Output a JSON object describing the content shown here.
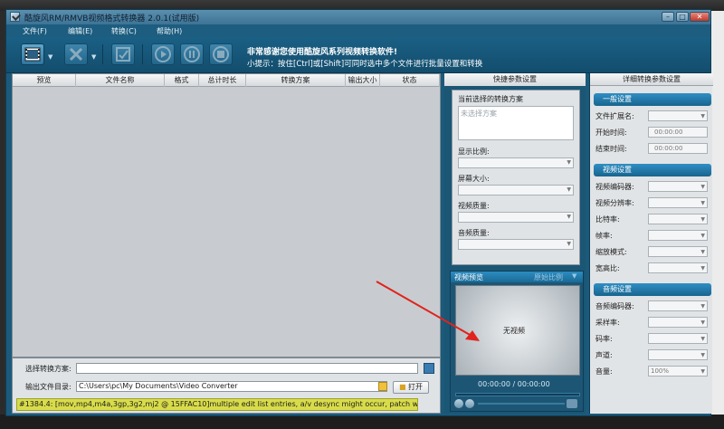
{
  "window": {
    "title": "酷旋风RM/RMVB视频格式转换器 2.0.1(试用版)"
  },
  "menu": [
    "文件(F)",
    "编辑(E)",
    "转换(C)",
    "帮助(H)"
  ],
  "toolbar": {
    "notice_main": "非常感谢您使用酷旋风系列视频转换软件!",
    "notice_tip": "小提示：按住[Ctrl]或[Shift]可同时选中多个文件进行批量设置和转换",
    "icons": [
      "add-video-icon",
      "remove-icon",
      "convert-icon",
      "play-icon",
      "pause-icon",
      "stop-icon"
    ]
  },
  "file_list": {
    "columns": [
      "预览",
      "文件名称",
      "格式",
      "总计时长",
      "转换方案",
      "输出大小",
      "状态"
    ]
  },
  "bottom": {
    "scheme_label": "选择转换方案:",
    "output_label": "输出文件目录:",
    "output_path": "C:\\Users\\pc\\My Documents\\Video Converter",
    "open_button": "打开",
    "status_text": "#1384.4: [mov,mp4,m4a,3gp,3g2,mj2 @ 15FFAC10]multiple edit list entries, a/v desync might occur, patch welcome"
  },
  "quick_settings": {
    "title": "快捷参数设置",
    "current_scheme_label": "当前选择的转换方案",
    "scheme_placeholder": "未选择方案",
    "aspect_label": "显示比例:",
    "screen_size_label": "屏幕大小:",
    "video_quality_label": "视频质量:",
    "audio_quality_label": "音频质量:"
  },
  "preview": {
    "title": "视频预览",
    "ratio": "原始比例",
    "no_video": "无视频",
    "current_time": "00:00:00",
    "separator": "/",
    "total_time": "00:00:00"
  },
  "detail": {
    "title": "详细转换参数设置",
    "general_group": "一般设置",
    "ext_label": "文件扩展名:",
    "start_label": "开始时间:",
    "end_label": "结束时间:",
    "start_value": "00:00:00",
    "end_value": "00:00:00",
    "video_group": "视频设置",
    "video_codec": "视频编码器:",
    "video_res": "视频分辨率:",
    "bitrate": "比特率:",
    "framerate": "帧率:",
    "scale_mode": "缩放模式:",
    "aspect": "宽高比:",
    "audio_group": "音频设置",
    "audio_codec": "音频编码器:",
    "sample_rate": "采样率:",
    "audio_bitrate": "码率:",
    "channels": "声道:",
    "volume": "音量:",
    "volume_value": "100%"
  }
}
